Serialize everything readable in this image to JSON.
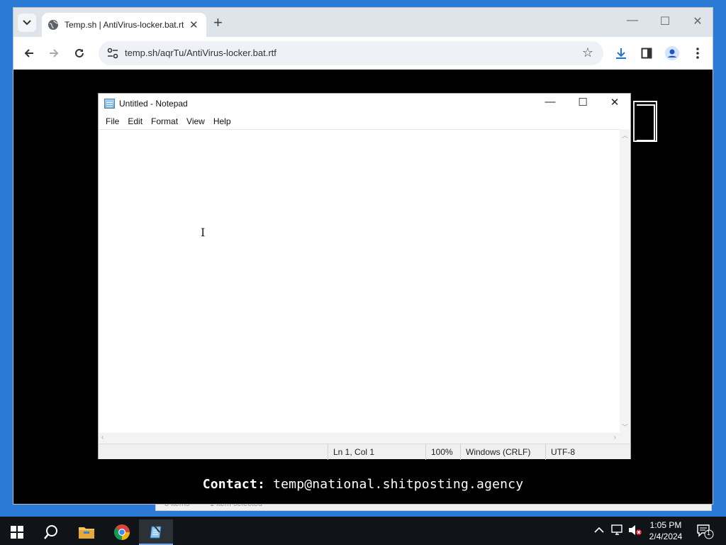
{
  "browser": {
    "tab_title": "Temp.sh | AntiVirus-locker.bat.rtf",
    "url": "temp.sh/aqrTu/AntiVirus-locker.bat.rtf"
  },
  "page": {
    "contact_label": "Contact:",
    "contact_email": "temp@national.shitposting.agency"
  },
  "explorer": {
    "items_text": "3 items",
    "selected_text": "1 item selected"
  },
  "notepad": {
    "title": "Untitled - Notepad",
    "menu": [
      "File",
      "Edit",
      "Format",
      "View",
      "Help"
    ],
    "content": "",
    "status": {
      "position": "Ln 1, Col 1",
      "zoom": "100%",
      "line_ending": "Windows (CRLF)",
      "encoding": "UTF-8"
    }
  },
  "taskbar": {
    "time": "1:05 PM",
    "date": "2/4/2024",
    "notification_count": "1"
  },
  "colors": {
    "chrome_frame": "#dee3ea",
    "page_bg": "#000000",
    "taskbar": "#101418",
    "accent": "#1a73e8"
  }
}
